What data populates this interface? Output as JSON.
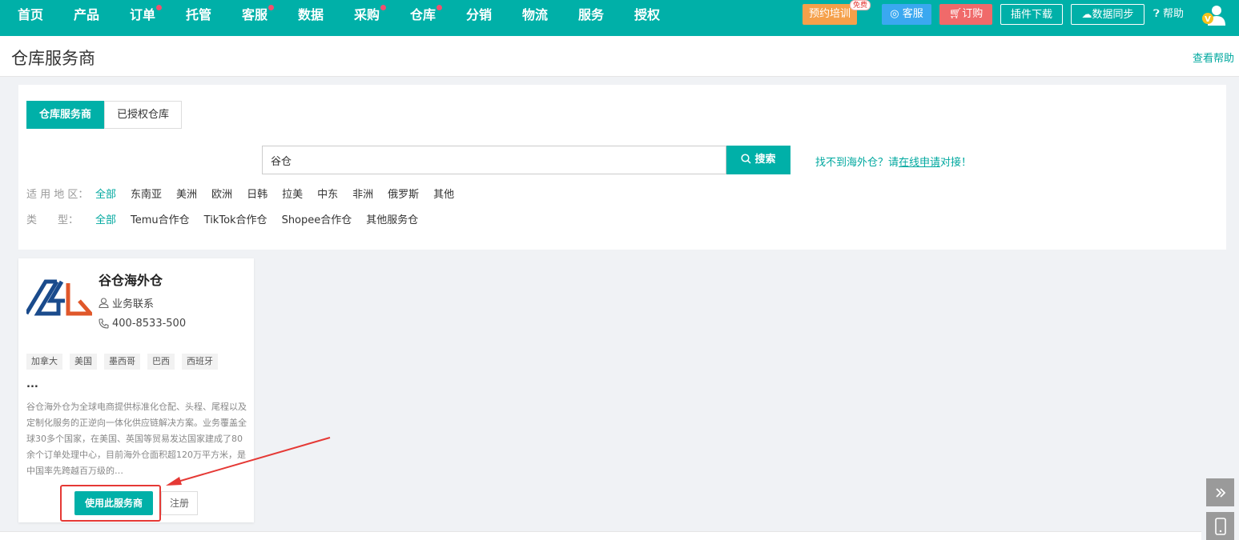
{
  "nav": {
    "items": [
      {
        "label": "首页",
        "dot": false
      },
      {
        "label": "产品",
        "dot": false
      },
      {
        "label": "订单",
        "dot": true
      },
      {
        "label": "托管",
        "dot": false
      },
      {
        "label": "客服",
        "dot": true
      },
      {
        "label": "数据",
        "dot": false
      },
      {
        "label": "采购",
        "dot": true
      },
      {
        "label": "仓库",
        "dot": true
      },
      {
        "label": "分销",
        "dot": false
      },
      {
        "label": "物流",
        "dot": false
      },
      {
        "label": "服务",
        "dot": false
      },
      {
        "label": "授权",
        "dot": false
      }
    ],
    "training": "预约培训",
    "free_badge": "免费",
    "kefu": "客服",
    "order": "订购",
    "plugin": "插件下载",
    "sync": "数据同步",
    "help": "帮助",
    "avatar_letter": "V"
  },
  "header": {
    "title": "仓库服务商",
    "help_link": "查看帮助"
  },
  "tabs": [
    {
      "label": "仓库服务商",
      "active": true
    },
    {
      "label": "已授权仓库",
      "active": false
    }
  ],
  "search": {
    "value": "谷仓",
    "button": "搜索",
    "tip_prefix": "找不到海外仓？请",
    "tip_link": "在线申请",
    "tip_suffix": "对接！"
  },
  "filters": {
    "region_label": "适 用 地 区：",
    "regions": [
      {
        "label": "全部",
        "active": true
      },
      {
        "label": "东南亚",
        "active": false
      },
      {
        "label": "美洲",
        "active": false
      },
      {
        "label": "欧洲",
        "active": false
      },
      {
        "label": "日韩",
        "active": false
      },
      {
        "label": "拉美",
        "active": false
      },
      {
        "label": "中东",
        "active": false
      },
      {
        "label": "非洲",
        "active": false
      },
      {
        "label": "俄罗斯",
        "active": false
      },
      {
        "label": "其他",
        "active": false
      }
    ],
    "type_label": "类　　型：",
    "types": [
      {
        "label": "全部",
        "active": true
      },
      {
        "label": "Temu合作仓",
        "active": false
      },
      {
        "label": "TikTok合作仓",
        "active": false
      },
      {
        "label": "Shopee合作仓",
        "active": false
      },
      {
        "label": "其他服务仓",
        "active": false
      }
    ]
  },
  "card": {
    "name": "谷仓海外仓",
    "contact": "业务联系",
    "phone": "400-8533-500",
    "regions": [
      "加拿大",
      "美国",
      "墨西哥",
      "巴西",
      "西班牙"
    ],
    "more": "...",
    "description": "谷仓海外仓为全球电商提供标准化仓配、头程、尾程以及定制化服务的正逆向一体化供应链解决方案。业务覆盖全球30多个国家，在美国、英国等贸易发达国家建成了80余个订单处理中心，目前海外仓面积超120万平方米，是中国率先跨越百万级的…",
    "use_button": "使用此服务商",
    "register_button": "注册"
  },
  "colors": {
    "brand": "#00b0a8",
    "highlight": "#e53935"
  }
}
